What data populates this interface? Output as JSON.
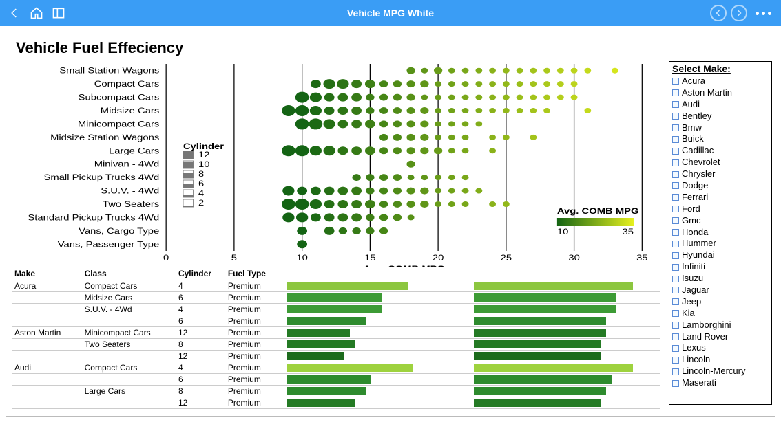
{
  "header": {
    "title": "Vehicle MPG White"
  },
  "chart_title": "Vehicle Fuel Effeciency",
  "right_panel": {
    "title": "Select Make:",
    "makes": [
      "Acura",
      "Aston Martin",
      "Audi",
      "Bentley",
      "Bmw",
      "Buick",
      "Cadillac",
      "Chevrolet",
      "Chrysler",
      "Dodge",
      "Ferrari",
      "Ford",
      "Gmc",
      "Honda",
      "Hummer",
      "Hyundai",
      "Infiniti",
      "Isuzu",
      "Jaguar",
      "Jeep",
      "Kia",
      "Lamborghini",
      "Land Rover",
      "Lexus",
      "Lincoln",
      "Lincoln-Mercury",
      "Maserati"
    ]
  },
  "scatter": {
    "categories": [
      "Small Station Wagons",
      "Compact Cars",
      "Subcompact Cars",
      "Midsize Cars",
      "Minicompact Cars",
      "Midsize Station Wagons",
      "Large Cars",
      "Minivan - 4Wd",
      "Small Pickup Trucks 4Wd",
      "S.U.V. - 4Wd",
      "Two Seaters",
      "Standard Pickup Trucks 4Wd",
      "Vans, Cargo Type",
      "Vans, Passenger Type"
    ],
    "x_ticks": [
      0,
      5,
      10,
      15,
      20,
      25,
      30,
      35
    ],
    "x_axis_label": "Avg. COMB MPG",
    "cyl_legend": {
      "title": "Cylinder",
      "items": [
        12,
        10,
        8,
        6,
        4,
        2
      ]
    },
    "color_legend": {
      "title": "Avg. COMB MPG",
      "min": 10,
      "max": 35
    }
  },
  "chart_data": {
    "type": "scatter",
    "title": "Vehicle Fuel Effeciency",
    "xlabel": "Avg. COMB MPG",
    "ylabel": "",
    "xlim": [
      0,
      35
    ],
    "categories": [
      "Small Station Wagons",
      "Compact Cars",
      "Subcompact Cars",
      "Midsize Cars",
      "Minicompact Cars",
      "Midsize Station Wagons",
      "Large Cars",
      "Minivan - 4Wd",
      "Small Pickup Trucks 4Wd",
      "S.U.V. - 4Wd",
      "Two Seaters",
      "Standard Pickup Trucks 4Wd",
      "Vans, Cargo Type",
      "Vans, Passenger Type"
    ],
    "size_encodes": "Cylinder",
    "size_levels": [
      12,
      10,
      8,
      6,
      4,
      2
    ],
    "color_encodes": "Avg. COMB MPG",
    "color_range": [
      10,
      35
    ],
    "points": [
      {
        "cat": 0,
        "x": 18,
        "cyl": 6
      },
      {
        "cat": 0,
        "x": 19,
        "cyl": 4
      },
      {
        "cat": 0,
        "x": 20,
        "cyl": 6
      },
      {
        "cat": 0,
        "x": 21,
        "cyl": 4
      },
      {
        "cat": 0,
        "x": 22,
        "cyl": 4
      },
      {
        "cat": 0,
        "x": 23,
        "cyl": 4
      },
      {
        "cat": 0,
        "x": 24,
        "cyl": 4
      },
      {
        "cat": 0,
        "x": 25,
        "cyl": 4
      },
      {
        "cat": 0,
        "x": 26,
        "cyl": 4
      },
      {
        "cat": 0,
        "x": 27,
        "cyl": 4
      },
      {
        "cat": 0,
        "x": 28,
        "cyl": 4
      },
      {
        "cat": 0,
        "x": 29,
        "cyl": 4
      },
      {
        "cat": 0,
        "x": 30,
        "cyl": 4
      },
      {
        "cat": 0,
        "x": 31,
        "cyl": 4
      },
      {
        "cat": 0,
        "x": 33,
        "cyl": 4
      },
      {
        "cat": 1,
        "x": 11,
        "cyl": 8
      },
      {
        "cat": 1,
        "x": 12,
        "cyl": 10
      },
      {
        "cat": 1,
        "x": 13,
        "cyl": 10
      },
      {
        "cat": 1,
        "x": 14,
        "cyl": 8
      },
      {
        "cat": 1,
        "x": 15,
        "cyl": 8
      },
      {
        "cat": 1,
        "x": 16,
        "cyl": 6
      },
      {
        "cat": 1,
        "x": 17,
        "cyl": 6
      },
      {
        "cat": 1,
        "x": 18,
        "cyl": 6
      },
      {
        "cat": 1,
        "x": 19,
        "cyl": 6
      },
      {
        "cat": 1,
        "x": 20,
        "cyl": 4
      },
      {
        "cat": 1,
        "x": 21,
        "cyl": 4
      },
      {
        "cat": 1,
        "x": 22,
        "cyl": 4
      },
      {
        "cat": 1,
        "x": 23,
        "cyl": 4
      },
      {
        "cat": 1,
        "x": 24,
        "cyl": 4
      },
      {
        "cat": 1,
        "x": 25,
        "cyl": 4
      },
      {
        "cat": 1,
        "x": 26,
        "cyl": 4
      },
      {
        "cat": 1,
        "x": 27,
        "cyl": 4
      },
      {
        "cat": 1,
        "x": 28,
        "cyl": 4
      },
      {
        "cat": 1,
        "x": 29,
        "cyl": 4
      },
      {
        "cat": 1,
        "x": 30,
        "cyl": 4
      },
      {
        "cat": 2,
        "x": 10,
        "cyl": 12
      },
      {
        "cat": 2,
        "x": 11,
        "cyl": 10
      },
      {
        "cat": 2,
        "x": 12,
        "cyl": 8
      },
      {
        "cat": 2,
        "x": 13,
        "cyl": 8
      },
      {
        "cat": 2,
        "x": 14,
        "cyl": 8
      },
      {
        "cat": 2,
        "x": 15,
        "cyl": 6
      },
      {
        "cat": 2,
        "x": 16,
        "cyl": 6
      },
      {
        "cat": 2,
        "x": 17,
        "cyl": 6
      },
      {
        "cat": 2,
        "x": 18,
        "cyl": 6
      },
      {
        "cat": 2,
        "x": 19,
        "cyl": 4
      },
      {
        "cat": 2,
        "x": 20,
        "cyl": 4
      },
      {
        "cat": 2,
        "x": 21,
        "cyl": 4
      },
      {
        "cat": 2,
        "x": 22,
        "cyl": 4
      },
      {
        "cat": 2,
        "x": 23,
        "cyl": 4
      },
      {
        "cat": 2,
        "x": 24,
        "cyl": 4
      },
      {
        "cat": 2,
        "x": 25,
        "cyl": 4
      },
      {
        "cat": 2,
        "x": 26,
        "cyl": 4
      },
      {
        "cat": 2,
        "x": 27,
        "cyl": 4
      },
      {
        "cat": 2,
        "x": 28,
        "cyl": 4
      },
      {
        "cat": 2,
        "x": 29,
        "cyl": 4
      },
      {
        "cat": 2,
        "x": 30,
        "cyl": 4
      },
      {
        "cat": 3,
        "x": 9,
        "cyl": 12
      },
      {
        "cat": 3,
        "x": 10,
        "cyl": 12
      },
      {
        "cat": 3,
        "x": 11,
        "cyl": 10
      },
      {
        "cat": 3,
        "x": 12,
        "cyl": 8
      },
      {
        "cat": 3,
        "x": 13,
        "cyl": 8
      },
      {
        "cat": 3,
        "x": 14,
        "cyl": 8
      },
      {
        "cat": 3,
        "x": 15,
        "cyl": 6
      },
      {
        "cat": 3,
        "x": 16,
        "cyl": 6
      },
      {
        "cat": 3,
        "x": 17,
        "cyl": 6
      },
      {
        "cat": 3,
        "x": 18,
        "cyl": 6
      },
      {
        "cat": 3,
        "x": 19,
        "cyl": 6
      },
      {
        "cat": 3,
        "x": 20,
        "cyl": 4
      },
      {
        "cat": 3,
        "x": 21,
        "cyl": 4
      },
      {
        "cat": 3,
        "x": 22,
        "cyl": 4
      },
      {
        "cat": 3,
        "x": 23,
        "cyl": 4
      },
      {
        "cat": 3,
        "x": 24,
        "cyl": 4
      },
      {
        "cat": 3,
        "x": 25,
        "cyl": 4
      },
      {
        "cat": 3,
        "x": 26,
        "cyl": 4
      },
      {
        "cat": 3,
        "x": 27,
        "cyl": 4
      },
      {
        "cat": 3,
        "x": 28,
        "cyl": 4
      },
      {
        "cat": 3,
        "x": 31,
        "cyl": 4
      },
      {
        "cat": 4,
        "x": 10,
        "cyl": 12
      },
      {
        "cat": 4,
        "x": 11,
        "cyl": 12
      },
      {
        "cat": 4,
        "x": 12,
        "cyl": 10
      },
      {
        "cat": 4,
        "x": 13,
        "cyl": 8
      },
      {
        "cat": 4,
        "x": 14,
        "cyl": 8
      },
      {
        "cat": 4,
        "x": 15,
        "cyl": 8
      },
      {
        "cat": 4,
        "x": 16,
        "cyl": 6
      },
      {
        "cat": 4,
        "x": 17,
        "cyl": 6
      },
      {
        "cat": 4,
        "x": 18,
        "cyl": 6
      },
      {
        "cat": 4,
        "x": 19,
        "cyl": 6
      },
      {
        "cat": 4,
        "x": 20,
        "cyl": 4
      },
      {
        "cat": 4,
        "x": 21,
        "cyl": 4
      },
      {
        "cat": 4,
        "x": 22,
        "cyl": 4
      },
      {
        "cat": 4,
        "x": 23,
        "cyl": 4
      },
      {
        "cat": 5,
        "x": 16,
        "cyl": 6
      },
      {
        "cat": 5,
        "x": 17,
        "cyl": 6
      },
      {
        "cat": 5,
        "x": 18,
        "cyl": 6
      },
      {
        "cat": 5,
        "x": 19,
        "cyl": 6
      },
      {
        "cat": 5,
        "x": 20,
        "cyl": 4
      },
      {
        "cat": 5,
        "x": 21,
        "cyl": 4
      },
      {
        "cat": 5,
        "x": 22,
        "cyl": 4
      },
      {
        "cat": 5,
        "x": 24,
        "cyl": 4
      },
      {
        "cat": 5,
        "x": 25,
        "cyl": 4
      },
      {
        "cat": 5,
        "x": 27,
        "cyl": 4
      },
      {
        "cat": 6,
        "x": 9,
        "cyl": 12
      },
      {
        "cat": 6,
        "x": 10,
        "cyl": 12
      },
      {
        "cat": 6,
        "x": 11,
        "cyl": 10
      },
      {
        "cat": 6,
        "x": 12,
        "cyl": 10
      },
      {
        "cat": 6,
        "x": 13,
        "cyl": 8
      },
      {
        "cat": 6,
        "x": 14,
        "cyl": 8
      },
      {
        "cat": 6,
        "x": 15,
        "cyl": 8
      },
      {
        "cat": 6,
        "x": 16,
        "cyl": 6
      },
      {
        "cat": 6,
        "x": 17,
        "cyl": 6
      },
      {
        "cat": 6,
        "x": 18,
        "cyl": 6
      },
      {
        "cat": 6,
        "x": 19,
        "cyl": 6
      },
      {
        "cat": 6,
        "x": 20,
        "cyl": 6
      },
      {
        "cat": 6,
        "x": 21,
        "cyl": 4
      },
      {
        "cat": 6,
        "x": 22,
        "cyl": 4
      },
      {
        "cat": 6,
        "x": 24,
        "cyl": 4
      },
      {
        "cat": 7,
        "x": 18,
        "cyl": 6
      },
      {
        "cat": 8,
        "x": 14,
        "cyl": 6
      },
      {
        "cat": 8,
        "x": 15,
        "cyl": 6
      },
      {
        "cat": 8,
        "x": 16,
        "cyl": 6
      },
      {
        "cat": 8,
        "x": 17,
        "cyl": 6
      },
      {
        "cat": 8,
        "x": 18,
        "cyl": 4
      },
      {
        "cat": 8,
        "x": 19,
        "cyl": 4
      },
      {
        "cat": 8,
        "x": 20,
        "cyl": 4
      },
      {
        "cat": 8,
        "x": 21,
        "cyl": 4
      },
      {
        "cat": 8,
        "x": 22,
        "cyl": 4
      },
      {
        "cat": 9,
        "x": 9,
        "cyl": 10
      },
      {
        "cat": 9,
        "x": 10,
        "cyl": 8
      },
      {
        "cat": 9,
        "x": 11,
        "cyl": 8
      },
      {
        "cat": 9,
        "x": 12,
        "cyl": 8
      },
      {
        "cat": 9,
        "x": 13,
        "cyl": 8
      },
      {
        "cat": 9,
        "x": 14,
        "cyl": 8
      },
      {
        "cat": 9,
        "x": 15,
        "cyl": 6
      },
      {
        "cat": 9,
        "x": 16,
        "cyl": 6
      },
      {
        "cat": 9,
        "x": 17,
        "cyl": 6
      },
      {
        "cat": 9,
        "x": 18,
        "cyl": 6
      },
      {
        "cat": 9,
        "x": 19,
        "cyl": 6
      },
      {
        "cat": 9,
        "x": 20,
        "cyl": 4
      },
      {
        "cat": 9,
        "x": 21,
        "cyl": 4
      },
      {
        "cat": 9,
        "x": 22,
        "cyl": 4
      },
      {
        "cat": 9,
        "x": 23,
        "cyl": 4
      },
      {
        "cat": 10,
        "x": 9,
        "cyl": 12
      },
      {
        "cat": 10,
        "x": 10,
        "cyl": 12
      },
      {
        "cat": 10,
        "x": 11,
        "cyl": 10
      },
      {
        "cat": 10,
        "x": 12,
        "cyl": 8
      },
      {
        "cat": 10,
        "x": 13,
        "cyl": 8
      },
      {
        "cat": 10,
        "x": 14,
        "cyl": 8
      },
      {
        "cat": 10,
        "x": 15,
        "cyl": 8
      },
      {
        "cat": 10,
        "x": 16,
        "cyl": 6
      },
      {
        "cat": 10,
        "x": 17,
        "cyl": 6
      },
      {
        "cat": 10,
        "x": 18,
        "cyl": 6
      },
      {
        "cat": 10,
        "x": 19,
        "cyl": 6
      },
      {
        "cat": 10,
        "x": 20,
        "cyl": 4
      },
      {
        "cat": 10,
        "x": 21,
        "cyl": 4
      },
      {
        "cat": 10,
        "x": 22,
        "cyl": 4
      },
      {
        "cat": 10,
        "x": 24,
        "cyl": 4
      },
      {
        "cat": 10,
        "x": 25,
        "cyl": 4
      },
      {
        "cat": 11,
        "x": 9,
        "cyl": 10
      },
      {
        "cat": 11,
        "x": 10,
        "cyl": 10
      },
      {
        "cat": 11,
        "x": 11,
        "cyl": 8
      },
      {
        "cat": 11,
        "x": 12,
        "cyl": 8
      },
      {
        "cat": 11,
        "x": 13,
        "cyl": 8
      },
      {
        "cat": 11,
        "x": 14,
        "cyl": 8
      },
      {
        "cat": 11,
        "x": 15,
        "cyl": 6
      },
      {
        "cat": 11,
        "x": 16,
        "cyl": 6
      },
      {
        "cat": 11,
        "x": 17,
        "cyl": 6
      },
      {
        "cat": 11,
        "x": 18,
        "cyl": 4
      },
      {
        "cat": 12,
        "x": 10,
        "cyl": 8
      },
      {
        "cat": 12,
        "x": 12,
        "cyl": 8
      },
      {
        "cat": 12,
        "x": 13,
        "cyl": 6
      },
      {
        "cat": 12,
        "x": 14,
        "cyl": 6
      },
      {
        "cat": 12,
        "x": 15,
        "cyl": 6
      },
      {
        "cat": 12,
        "x": 16,
        "cyl": 6
      },
      {
        "cat": 13,
        "x": 10,
        "cyl": 8
      }
    ]
  },
  "table": {
    "columns": [
      "Make",
      "Class",
      "Cylinder",
      "Fuel Type"
    ],
    "rows": [
      {
        "make": "Acura",
        "class": "Compact Cars",
        "cyl": "4",
        "fuel": "Premium",
        "b1": 23,
        "c1": "#8cc63f",
        "b2": 30,
        "c2": "#8cc63f",
        "first": true
      },
      {
        "make": "",
        "class": "Midsize Cars",
        "cyl": "6",
        "fuel": "Premium",
        "b1": 18,
        "c1": "#3d9b35",
        "b2": 27,
        "c2": "#3d9b35"
      },
      {
        "make": "",
        "class": "S.U.V. - 4Wd",
        "cyl": "4",
        "fuel": "Premium",
        "b1": 18,
        "c1": "#3d9b35",
        "b2": 27,
        "c2": "#3d9b35"
      },
      {
        "make": "",
        "class": "",
        "cyl": "6",
        "fuel": "Premium",
        "b1": 15,
        "c1": "#2e8b2e",
        "b2": 25,
        "c2": "#2e8b2e"
      },
      {
        "make": "Aston Martin",
        "class": "Minicompact Cars",
        "cyl": "12",
        "fuel": "Premium",
        "b1": 12,
        "c1": "#247a24",
        "b2": 25,
        "c2": "#247a24",
        "first": true
      },
      {
        "make": "",
        "class": "Two Seaters",
        "cyl": "8",
        "fuel": "Premium",
        "b1": 13,
        "c1": "#247a24",
        "b2": 24,
        "c2": "#247a24"
      },
      {
        "make": "",
        "class": "",
        "cyl": "12",
        "fuel": "Premium",
        "b1": 11,
        "c1": "#1c6b1c",
        "b2": 24,
        "c2": "#1c6b1c"
      },
      {
        "make": "Audi",
        "class": "Compact Cars",
        "cyl": "4",
        "fuel": "Premium",
        "b1": 24,
        "c1": "#9ed23e",
        "b2": 30,
        "c2": "#9ed23e",
        "first": true
      },
      {
        "make": "",
        "class": "",
        "cyl": "6",
        "fuel": "Premium",
        "b1": 16,
        "c1": "#2e8b2e",
        "b2": 26,
        "c2": "#2e8b2e"
      },
      {
        "make": "",
        "class": "Large Cars",
        "cyl": "8",
        "fuel": "Premium",
        "b1": 15,
        "c1": "#2e8b2e",
        "b2": 25,
        "c2": "#2e8b2e"
      },
      {
        "make": "",
        "class": "",
        "cyl": "12",
        "fuel": "Premium",
        "b1": 13,
        "c1": "#247a24",
        "b2": 24,
        "c2": "#247a24"
      }
    ]
  }
}
